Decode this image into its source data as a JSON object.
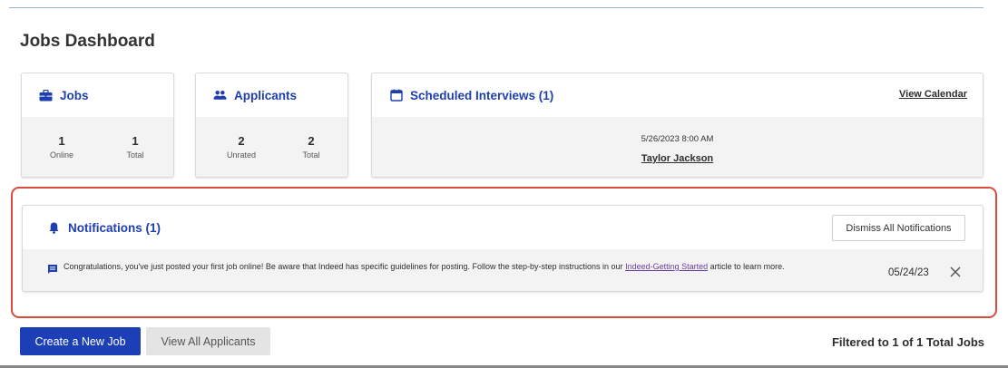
{
  "page": {
    "title": "Jobs Dashboard"
  },
  "jobs_card": {
    "title": "Jobs",
    "stats": [
      {
        "value": "1",
        "label": "Online"
      },
      {
        "value": "1",
        "label": "Total"
      }
    ]
  },
  "applicants_card": {
    "title": "Applicants",
    "stats": [
      {
        "value": "2",
        "label": "Unrated"
      },
      {
        "value": "2",
        "label": "Total"
      }
    ]
  },
  "interviews_card": {
    "title": "Scheduled Interviews (1)",
    "view_calendar_label": "View Calendar",
    "interview": {
      "datetime": "5/26/2023 8:00 AM",
      "candidate": "Taylor Jackson"
    }
  },
  "notifications": {
    "title": "Notifications (1)",
    "dismiss_all_label": "Dismiss All Notifications",
    "items": [
      {
        "text_before": "Congratulations, you've just posted your first job online! Be aware that Indeed has specific guidelines for posting. Follow the step-by-step instructions in our ",
        "link_text": "Indeed-Getting Started",
        "text_after": " article to learn more.",
        "date": "05/24/23"
      }
    ]
  },
  "actions": {
    "create_job_label": "Create a New Job",
    "view_applicants_label": "View All Applicants"
  },
  "footer": {
    "filter_text": "Filtered to 1 of 1 Total Jobs"
  },
  "colors": {
    "accent": "#1d3fb5",
    "link_visited": "#6b3fa0",
    "highlight_border": "#d94c3d"
  }
}
